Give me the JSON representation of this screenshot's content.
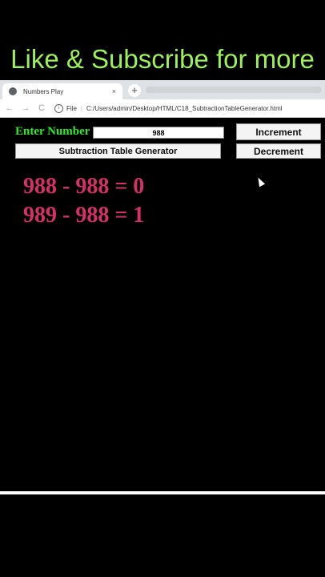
{
  "overlay": {
    "banner_text": "Like & Subscribe for more"
  },
  "browser": {
    "tab_title": "Numbers Play",
    "tab_close": "×",
    "new_tab": "+",
    "back": "←",
    "forward": "→",
    "reload": "C",
    "info_icon": "i",
    "scheme_label": "File",
    "url": "C:/Users/admin/Desktop/HTML/C18_SubtractionTableGenerator.html"
  },
  "app": {
    "enter_label": "Enter Number",
    "input_value": "988",
    "increment_label": "Increment",
    "decrement_label": "Decrement",
    "generate_label": "Subtraction Table Generator",
    "results": [
      "988 - 988 = 0",
      "989 - 988 = 1"
    ]
  },
  "colors": {
    "banner": "#9df05a",
    "label_green": "#2ee82e",
    "result_pink": "#d6306a"
  }
}
